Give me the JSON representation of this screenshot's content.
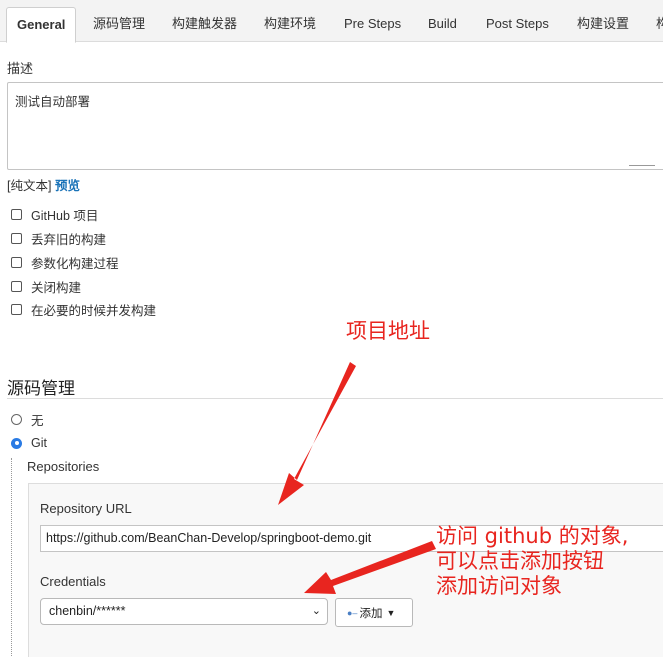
{
  "tabs": [
    {
      "label": "General",
      "active": true
    },
    {
      "label": "源码管理"
    },
    {
      "label": "构建触发器"
    },
    {
      "label": "构建环境"
    },
    {
      "label": "Pre Steps"
    },
    {
      "label": "Build"
    },
    {
      "label": "Post Steps"
    },
    {
      "label": "构建设置"
    },
    {
      "label": "构"
    }
  ],
  "general": {
    "description_label": "描述",
    "description_value": "测试自动部署",
    "format_plain": "[纯文本]",
    "format_preview": "预览",
    "options": [
      {
        "label": "GitHub 项目",
        "checked": false
      },
      {
        "label": "丢弃旧的构建",
        "checked": false
      },
      {
        "label": "参数化构建过程",
        "checked": false
      },
      {
        "label": "关闭构建",
        "checked": false
      },
      {
        "label": "在必要的时候并发构建",
        "checked": false
      }
    ]
  },
  "scm": {
    "title": "源码管理",
    "options": [
      {
        "label": "无",
        "selected": false
      },
      {
        "label": "Git",
        "selected": true
      }
    ],
    "repositories_label": "Repositories",
    "repo_url_label": "Repository URL",
    "repo_url_value": "https://github.com/BeanChan-Develop/springboot-demo.git",
    "credentials_label": "Credentials",
    "credentials_value": "chenbin/******",
    "add_button_label": "添加"
  },
  "annotations": {
    "project_address": "项目地址",
    "access_line1": "访问 github 的对象,",
    "access_line2": "可以点击添加按钮",
    "access_line3": "添加访问对象"
  },
  "colors": {
    "annotation_red": "#e8251f",
    "link_blue": "#1a73b8",
    "radio_blue": "#2a7be4"
  }
}
